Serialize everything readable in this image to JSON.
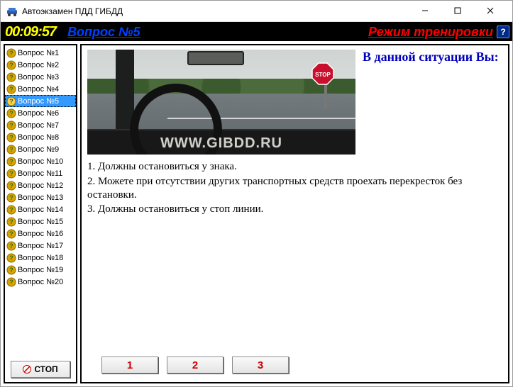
{
  "title": "Автоэкзамен ПДД ГИБДД",
  "timer": "00:09:57",
  "question_link": "Вопрос №5",
  "mode_link": "Режим тренировки",
  "help_label": "?",
  "sidebar": {
    "items": [
      {
        "label": "Вопрос №1",
        "selected": false
      },
      {
        "label": "Вопрос №2",
        "selected": false
      },
      {
        "label": "Вопрос №3",
        "selected": false
      },
      {
        "label": "Вопрос №4",
        "selected": false
      },
      {
        "label": "Вопрос №5",
        "selected": true
      },
      {
        "label": "Вопрос №6",
        "selected": false
      },
      {
        "label": "Вопрос №7",
        "selected": false
      },
      {
        "label": "Вопрос №8",
        "selected": false
      },
      {
        "label": "Вопрос №9",
        "selected": false
      },
      {
        "label": "Вопрос №10",
        "selected": false
      },
      {
        "label": "Вопрос №11",
        "selected": false
      },
      {
        "label": "Вопрос №12",
        "selected": false
      },
      {
        "label": "Вопрос №13",
        "selected": false
      },
      {
        "label": "Вопрос №14",
        "selected": false
      },
      {
        "label": "Вопрос №15",
        "selected": false
      },
      {
        "label": "Вопрос №16",
        "selected": false
      },
      {
        "label": "Вопрос №17",
        "selected": false
      },
      {
        "label": "Вопрос №18",
        "selected": false
      },
      {
        "label": "Вопрос №19",
        "selected": false
      },
      {
        "label": "Вопрос №20",
        "selected": false
      }
    ],
    "stop_label": "СТОП"
  },
  "scene": {
    "watermark": "WWW.GIBDD.RU",
    "sign_text": "STOP"
  },
  "question": {
    "prompt": "В данной ситуации Вы:",
    "answers": [
      "1. Должны остановиться у знака.",
      "2. Можете при отсутствии других транспортных средств проехать перекресток без остановки.",
      "3. Должны остановиться у стоп линии."
    ]
  },
  "answer_buttons": [
    "1",
    "2",
    "3"
  ]
}
